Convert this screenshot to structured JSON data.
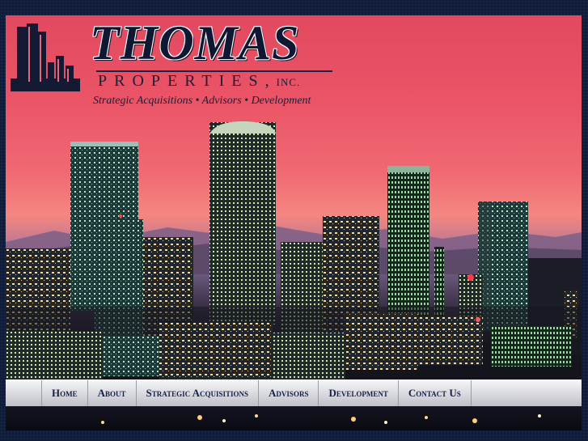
{
  "brand": {
    "name": "THOMAS",
    "subtitle": "PROPERTIES,",
    "suffix": "INC.",
    "tagline": "Strategic Acquisitions • Advisors • Development"
  },
  "nav": {
    "items": [
      {
        "label": "Home"
      },
      {
        "label": "About"
      },
      {
        "label": "Strategic Acquisitions"
      },
      {
        "label": "Advisors"
      },
      {
        "label": "Development"
      },
      {
        "label": "Contact Us"
      }
    ]
  },
  "colors": {
    "sky_top": "#e2495f",
    "sky_horizon": "#f58680",
    "frame_bg": "#0f1c3a",
    "nav_text": "#16214a",
    "brand_navy": "#0f1732"
  },
  "icons": {
    "logo": "building-skyline-icon"
  }
}
